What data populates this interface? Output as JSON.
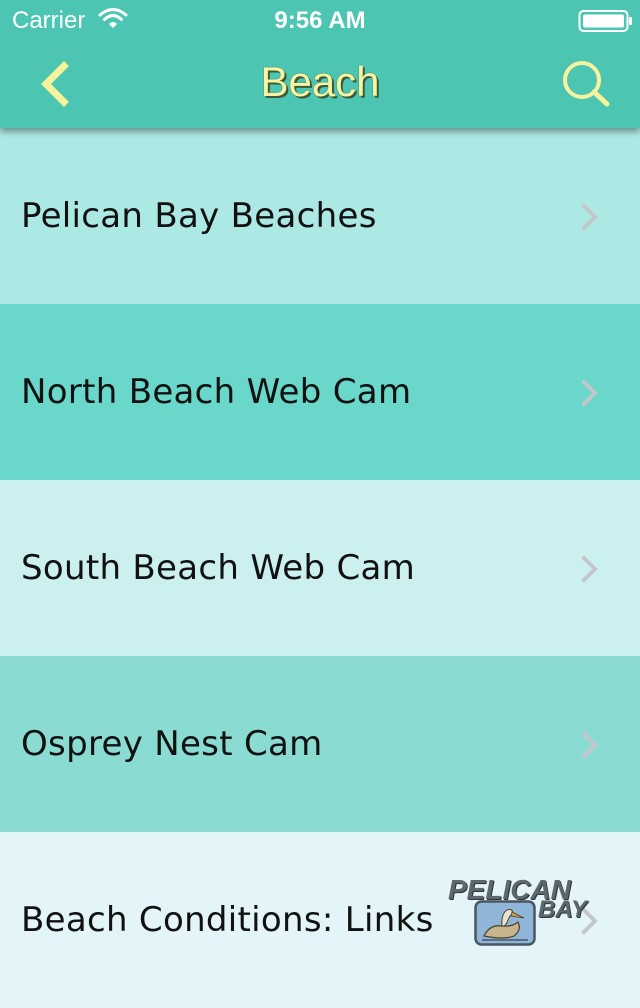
{
  "status_bar": {
    "carrier": "Carrier",
    "time": "9:56 AM",
    "wifi_icon": "wifi-icon",
    "battery_icon": "battery-icon"
  },
  "nav": {
    "title": "Beach",
    "back_icon": "chevron-left-icon",
    "search_icon": "search-icon"
  },
  "list": {
    "items": [
      {
        "label": "Pelican Bay Beaches",
        "bg": "#ade9e4"
      },
      {
        "label": "North Beach Web Cam",
        "bg": "#69d7c9"
      },
      {
        "label": "South Beach Web Cam",
        "bg": "#ccf0f0"
      },
      {
        "label": "Osprey Nest Cam",
        "bg": "#8adcd2"
      },
      {
        "label": "Beach Conditions: Links",
        "bg": "#e3f5f9"
      }
    ],
    "chevron_icon": "chevron-right-icon"
  },
  "logo": {
    "line1": "PELICAN",
    "line2": "BAY"
  },
  "colors": {
    "header_bg": "#4cc6b2",
    "title_color": "#f8f4a0",
    "icon_color": "#f7f39c",
    "chevron_color": "#c4c7c9"
  }
}
